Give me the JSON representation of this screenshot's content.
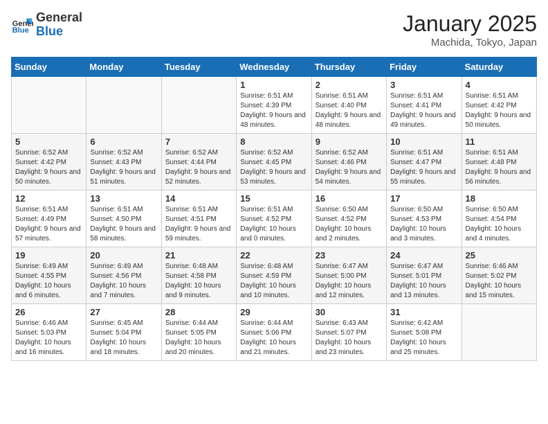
{
  "header": {
    "logo_general": "General",
    "logo_blue": "Blue",
    "title": "January 2025",
    "subtitle": "Machida, Tokyo, Japan"
  },
  "days_of_week": [
    "Sunday",
    "Monday",
    "Tuesday",
    "Wednesday",
    "Thursday",
    "Friday",
    "Saturday"
  ],
  "weeks": [
    [
      {
        "day": "",
        "info": ""
      },
      {
        "day": "",
        "info": ""
      },
      {
        "day": "",
        "info": ""
      },
      {
        "day": "1",
        "info": "Sunrise: 6:51 AM\nSunset: 4:39 PM\nDaylight: 9 hours and 48 minutes."
      },
      {
        "day": "2",
        "info": "Sunrise: 6:51 AM\nSunset: 4:40 PM\nDaylight: 9 hours and 48 minutes."
      },
      {
        "day": "3",
        "info": "Sunrise: 6:51 AM\nSunset: 4:41 PM\nDaylight: 9 hours and 49 minutes."
      },
      {
        "day": "4",
        "info": "Sunrise: 6:51 AM\nSunset: 4:42 PM\nDaylight: 9 hours and 50 minutes."
      }
    ],
    [
      {
        "day": "5",
        "info": "Sunrise: 6:52 AM\nSunset: 4:42 PM\nDaylight: 9 hours and 50 minutes."
      },
      {
        "day": "6",
        "info": "Sunrise: 6:52 AM\nSunset: 4:43 PM\nDaylight: 9 hours and 51 minutes."
      },
      {
        "day": "7",
        "info": "Sunrise: 6:52 AM\nSunset: 4:44 PM\nDaylight: 9 hours and 52 minutes."
      },
      {
        "day": "8",
        "info": "Sunrise: 6:52 AM\nSunset: 4:45 PM\nDaylight: 9 hours and 53 minutes."
      },
      {
        "day": "9",
        "info": "Sunrise: 6:52 AM\nSunset: 4:46 PM\nDaylight: 9 hours and 54 minutes."
      },
      {
        "day": "10",
        "info": "Sunrise: 6:51 AM\nSunset: 4:47 PM\nDaylight: 9 hours and 55 minutes."
      },
      {
        "day": "11",
        "info": "Sunrise: 6:51 AM\nSunset: 4:48 PM\nDaylight: 9 hours and 56 minutes."
      }
    ],
    [
      {
        "day": "12",
        "info": "Sunrise: 6:51 AM\nSunset: 4:49 PM\nDaylight: 9 hours and 57 minutes."
      },
      {
        "day": "13",
        "info": "Sunrise: 6:51 AM\nSunset: 4:50 PM\nDaylight: 9 hours and 58 minutes."
      },
      {
        "day": "14",
        "info": "Sunrise: 6:51 AM\nSunset: 4:51 PM\nDaylight: 9 hours and 59 minutes."
      },
      {
        "day": "15",
        "info": "Sunrise: 6:51 AM\nSunset: 4:52 PM\nDaylight: 10 hours and 0 minutes."
      },
      {
        "day": "16",
        "info": "Sunrise: 6:50 AM\nSunset: 4:52 PM\nDaylight: 10 hours and 2 minutes."
      },
      {
        "day": "17",
        "info": "Sunrise: 6:50 AM\nSunset: 4:53 PM\nDaylight: 10 hours and 3 minutes."
      },
      {
        "day": "18",
        "info": "Sunrise: 6:50 AM\nSunset: 4:54 PM\nDaylight: 10 hours and 4 minutes."
      }
    ],
    [
      {
        "day": "19",
        "info": "Sunrise: 6:49 AM\nSunset: 4:55 PM\nDaylight: 10 hours and 6 minutes."
      },
      {
        "day": "20",
        "info": "Sunrise: 6:49 AM\nSunset: 4:56 PM\nDaylight: 10 hours and 7 minutes."
      },
      {
        "day": "21",
        "info": "Sunrise: 6:48 AM\nSunset: 4:58 PM\nDaylight: 10 hours and 9 minutes."
      },
      {
        "day": "22",
        "info": "Sunrise: 6:48 AM\nSunset: 4:59 PM\nDaylight: 10 hours and 10 minutes."
      },
      {
        "day": "23",
        "info": "Sunrise: 6:47 AM\nSunset: 5:00 PM\nDaylight: 10 hours and 12 minutes."
      },
      {
        "day": "24",
        "info": "Sunrise: 6:47 AM\nSunset: 5:01 PM\nDaylight: 10 hours and 13 minutes."
      },
      {
        "day": "25",
        "info": "Sunrise: 6:46 AM\nSunset: 5:02 PM\nDaylight: 10 hours and 15 minutes."
      }
    ],
    [
      {
        "day": "26",
        "info": "Sunrise: 6:46 AM\nSunset: 5:03 PM\nDaylight: 10 hours and 16 minutes."
      },
      {
        "day": "27",
        "info": "Sunrise: 6:45 AM\nSunset: 5:04 PM\nDaylight: 10 hours and 18 minutes."
      },
      {
        "day": "28",
        "info": "Sunrise: 6:44 AM\nSunset: 5:05 PM\nDaylight: 10 hours and 20 minutes."
      },
      {
        "day": "29",
        "info": "Sunrise: 6:44 AM\nSunset: 5:06 PM\nDaylight: 10 hours and 21 minutes."
      },
      {
        "day": "30",
        "info": "Sunrise: 6:43 AM\nSunset: 5:07 PM\nDaylight: 10 hours and 23 minutes."
      },
      {
        "day": "31",
        "info": "Sunrise: 6:42 AM\nSunset: 5:08 PM\nDaylight: 10 hours and 25 minutes."
      },
      {
        "day": "",
        "info": ""
      }
    ]
  ]
}
